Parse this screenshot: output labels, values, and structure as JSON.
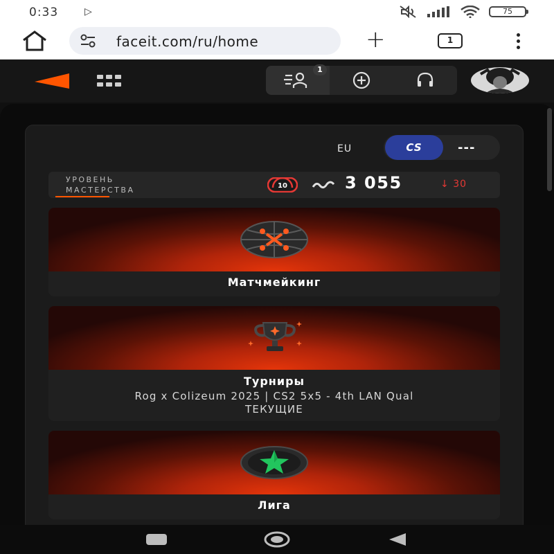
{
  "status_bar": {
    "time": "0:33",
    "battery": "75",
    "icons": [
      "cast-icon",
      "mute-icon",
      "signal-icon",
      "wifi-icon",
      "battery-icon"
    ]
  },
  "browser": {
    "url": "faceit.com/ru/home",
    "tab_count": "1",
    "icons": [
      "home-icon",
      "site-settings-icon",
      "new-tab-icon",
      "tabs-icon",
      "menu-icon"
    ]
  },
  "header": {
    "notification_count": "1",
    "accent_color": "#ff5500",
    "icons": [
      "faceit-logo",
      "apps-grid-icon",
      "friends-icon",
      "add-icon",
      "headset-icon",
      "avatar"
    ]
  },
  "game": {
    "region": "EU",
    "game_label": "CS",
    "game_extra": "---",
    "badge_color": "#2b3e9b"
  },
  "mastery": {
    "label_line1": "УРОВЕНЬ",
    "label_line2": "МАСТЕРСТВА",
    "level": "10",
    "elo": "3 055",
    "elo_change": "30",
    "level_color": "#e53935"
  },
  "sections": {
    "matchmaking": {
      "title": "Матчмейкинг"
    },
    "tournaments": {
      "title": "Турниры",
      "subtitle": "Rog x Colizeum 2025 | CS2 5x5 - 4th LAN Qual",
      "status": "ТЕКУЩИЕ"
    },
    "league": {
      "title": "Лига"
    }
  },
  "nav_bar": {
    "icons": [
      "recents-icon",
      "home-circle-icon",
      "back-icon"
    ]
  }
}
